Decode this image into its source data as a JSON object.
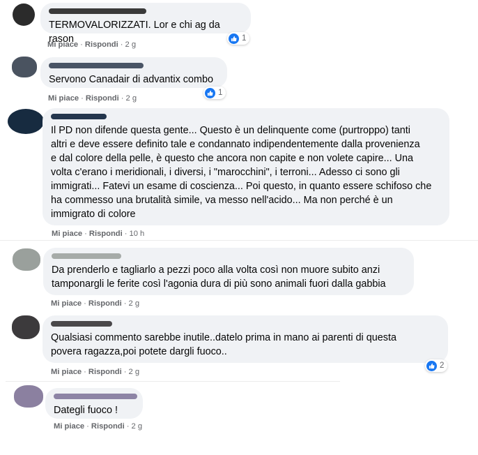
{
  "colors": {
    "bubble": "#f0f2f5",
    "meta_text": "#65676b",
    "like_blue": "#1877f2"
  },
  "comments": [
    {
      "text": "TERMOVALORIZZATI. Lor e chi ag da rason",
      "like": "Mi piace",
      "reply": "Rispondi",
      "time": "2 g",
      "reactions": "1",
      "reaction_icon": "like-icon"
    },
    {
      "text": "Servono Canadair di advantix combo",
      "like": "Mi piace",
      "reply": "Rispondi",
      "time": "2 g",
      "reactions": "1",
      "reaction_icon": "like-icon"
    },
    {
      "text": "Il PD non difende questa gente... Questo è un delinquente come (purtroppo) tanti\naltri e deve essere definito tale e condannato indipendentemente dalla provenienza\ne dal colore della pelle, è questo che ancora non capite e non volete capire... Una\nvolta c'erano i meridionali, i diversi, i \"marocchini\", i terroni... Adesso ci sono gli\nimmigrati... Fatevi un esame di coscienza... Poi questo, in quanto essere schifoso che\nha commesso una brutalità simile, va messo nell'acido... Ma non perché è un\nimmigrato di colore",
      "like": "Mi piace",
      "reply": "Rispondi",
      "time": "10 h"
    },
    {
      "text": "Da prenderlo e tagliarlo a pezzi poco alla volta così non muore subito anzi\ntamponargli le ferite così l'agonia dura di più sono animali fuori dalla gabbia",
      "like": "Mi piace",
      "reply": "Rispondi",
      "time": "2 g"
    },
    {
      "text": "Qualsiasi commento sarebbe inutile..datelo prima in mano ai parenti di questa\npovera ragazza,poi potete dargli fuoco..",
      "like": "Mi piace",
      "reply": "Rispondi",
      "time": "2 g",
      "reactions": "2",
      "reaction_icon": "like-icon"
    },
    {
      "text": "Dategli fuoco !",
      "like": "Mi piace",
      "reply": "Rispondi",
      "time": "2 g"
    }
  ]
}
